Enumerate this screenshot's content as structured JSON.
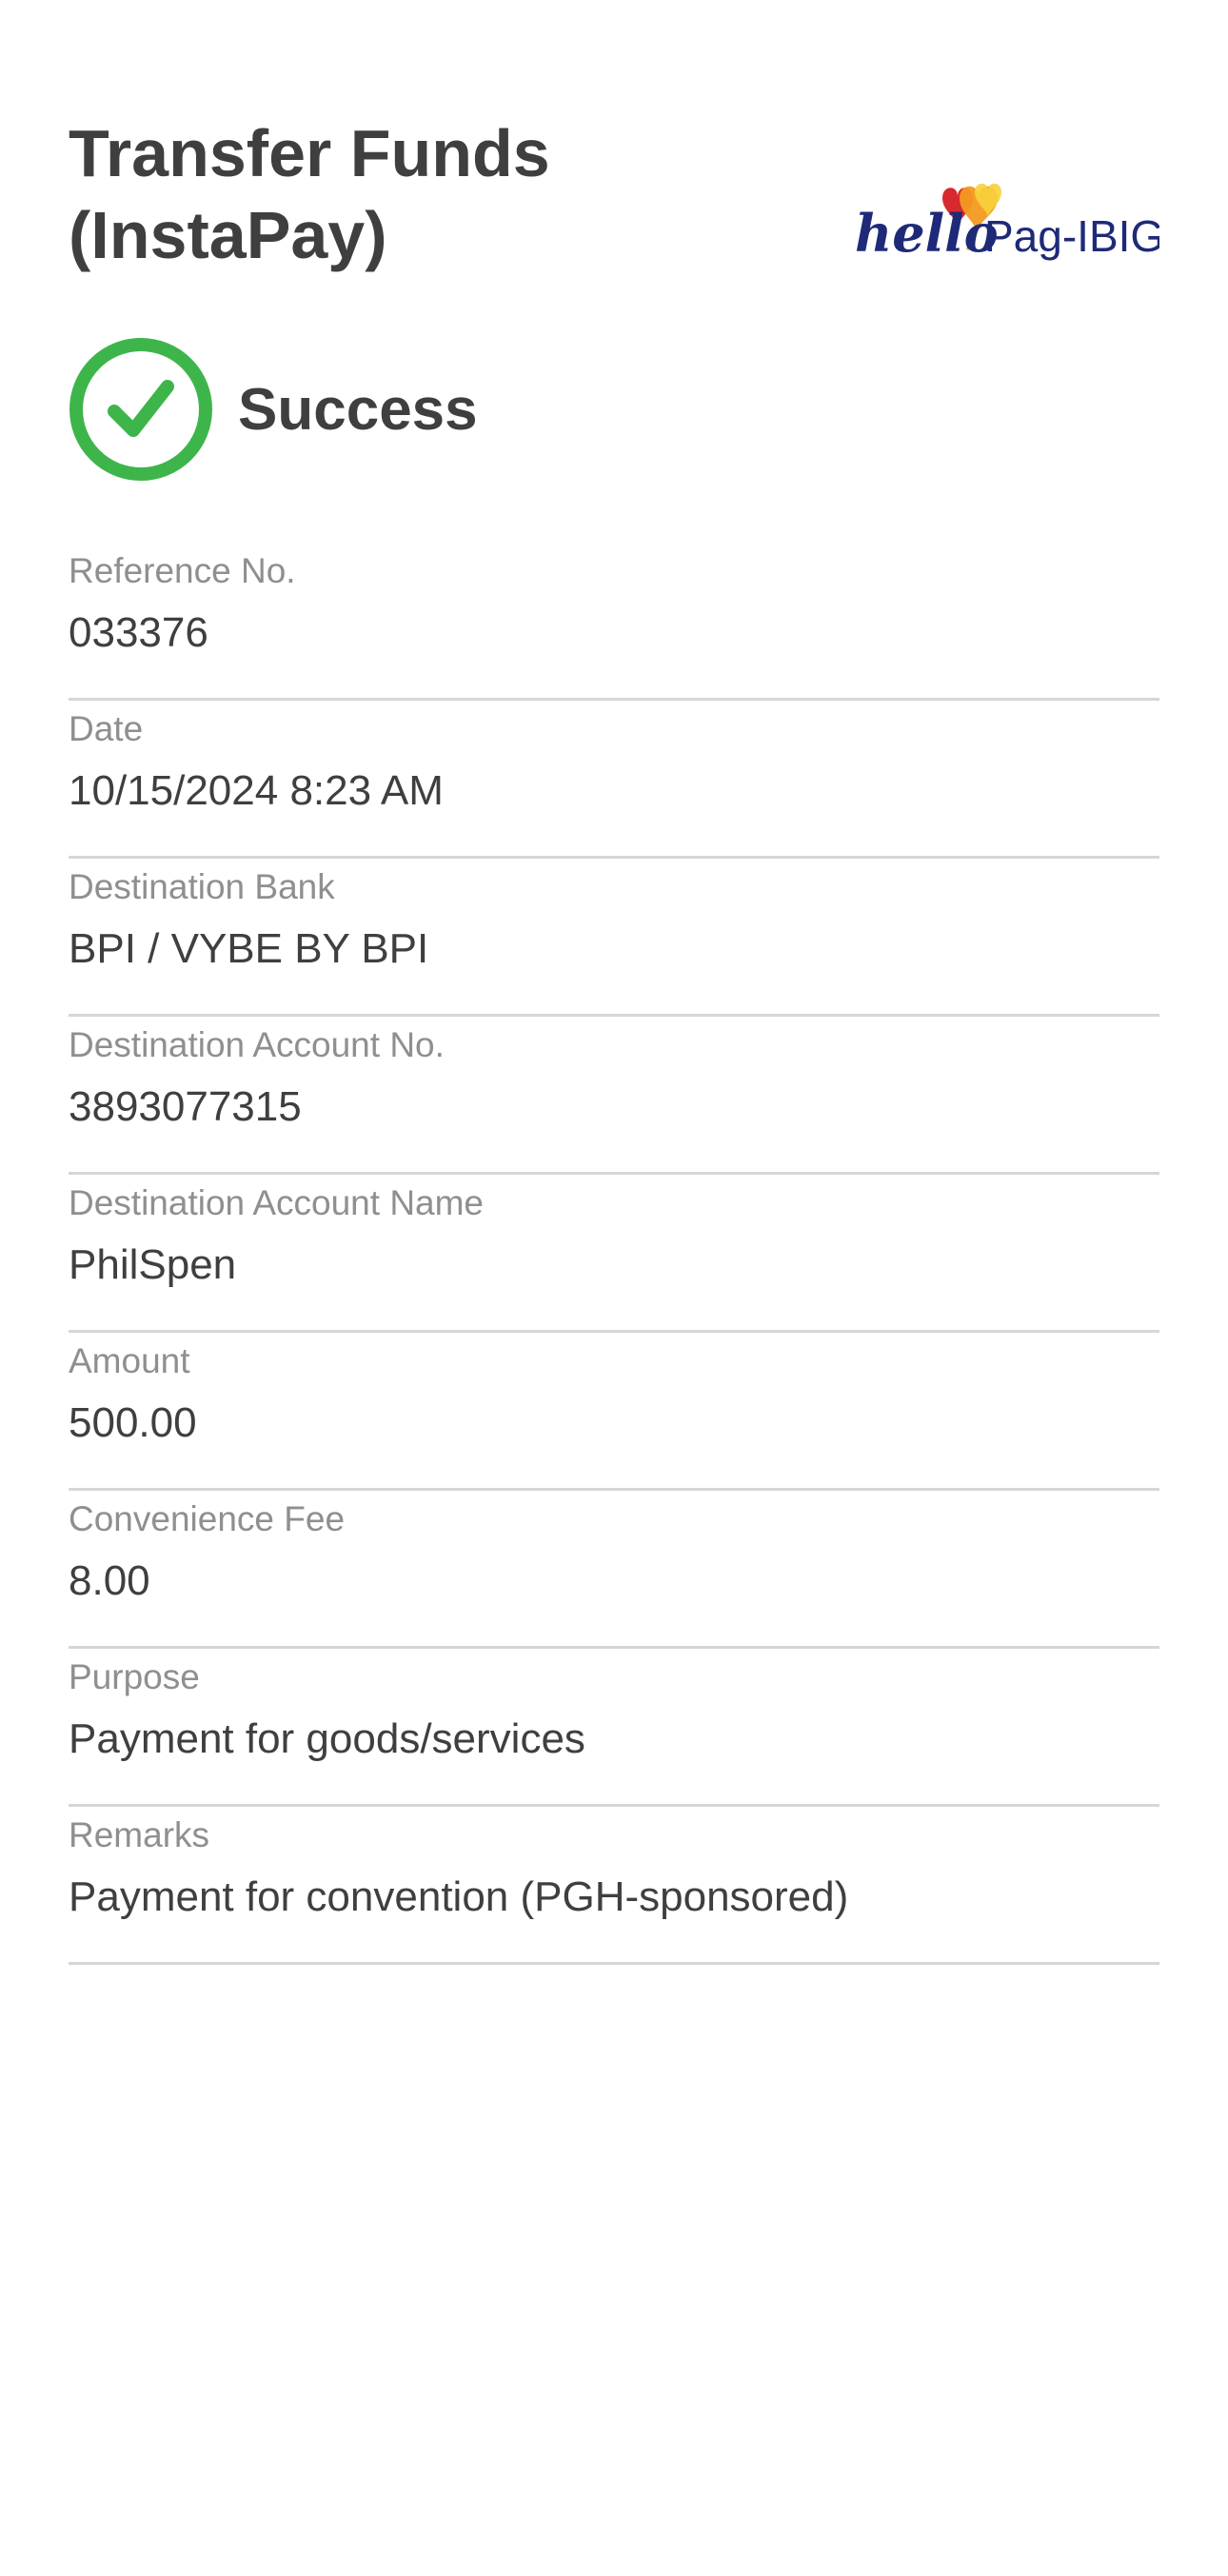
{
  "header": {
    "title": "Transfer Funds\n(InstaPay)",
    "logo_text": "hello Pag-IBIG",
    "logo_icon": "balloon-hearts-icon"
  },
  "status": {
    "icon": "check-circle-icon",
    "text": "Success",
    "color": "#3db54a"
  },
  "details": [
    {
      "label": "Reference No.",
      "value": "033376"
    },
    {
      "label": "Date",
      "value": "10/15/2024 8:23 AM"
    },
    {
      "label": "Destination Bank",
      "value": "BPI / VYBE BY BPI"
    },
    {
      "label": "Destination Account No.",
      "value": "3893077315"
    },
    {
      "label": "Destination Account Name",
      "value": "PhilSpen"
    },
    {
      "label": "Amount",
      "value": "500.00"
    },
    {
      "label": "Convenience Fee",
      "value": "8.00"
    },
    {
      "label": "Purpose",
      "value": "Payment for goods/services"
    },
    {
      "label": "Remarks",
      "value": "Payment for convention (PGH-sponsored)"
    }
  ],
  "colors": {
    "text": "#3f3f3f",
    "label": "#8f8f8f",
    "divider": "#d6d6d6",
    "logo_navy": "#1e2a78",
    "logo_red": "#d8292f",
    "logo_orange": "#f39a1f",
    "logo_yellow": "#f7d13b"
  }
}
